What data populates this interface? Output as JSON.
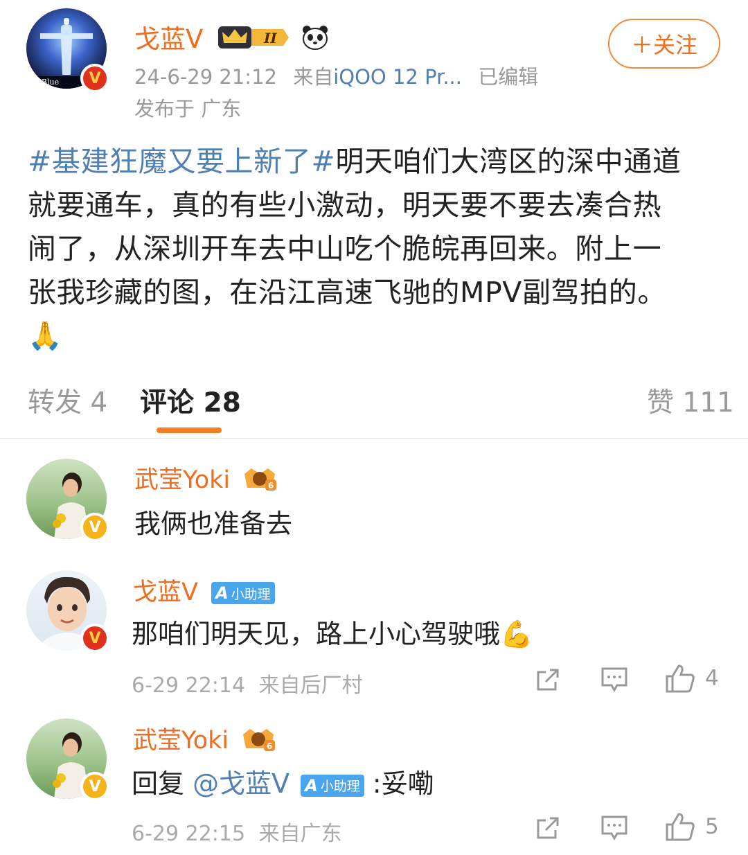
{
  "post": {
    "author": "戈蓝V",
    "level_badge": "II",
    "timestamp": "24-6-29 21:12",
    "source_prefix": "来自",
    "source_device": "iQOO 12 Pr...",
    "edited": "已编辑",
    "location": "发布于 广东",
    "follow_label": "＋关注",
    "avatar_caption": "t Blue",
    "hashtag": "#基建狂魔又要上新了#",
    "lines": [
      "明天咱们大湾区的深中通道",
      "就要通车，真的有些小激动，明天要不要去凑合热",
      "闹了，从深圳开车去中山吃个脆皖再回来。附上一",
      "张我珍藏的图，在沿江高速飞驰的MPV副驾拍的。"
    ],
    "emoji": "🙏"
  },
  "tabs": {
    "repost": "转发 4",
    "comments": "评论 28",
    "likes": "赞 111"
  },
  "comments": [
    {
      "name": "武莹Yoki",
      "text": "我俩也准备去"
    },
    {
      "name": "戈蓝V",
      "assistant_badge": "小助理",
      "text": "那咱们明天见，路上小心驾驶哦",
      "emoji": "💪",
      "time": "6-29 22:14",
      "source": "来自后厂村",
      "like_count": "4"
    },
    {
      "name": "武莹Yoki",
      "reply_prefix": "回复",
      "mention": "@戈蓝V",
      "assistant_badge": "小助理",
      "text": ":妥嘞",
      "time": "6-29 22:15",
      "source": "来自广东",
      "like_count": "5"
    }
  ],
  "colors": {
    "accent_orange": "#f06d1f",
    "link_blue": "#4f7fb3",
    "underline": "#f37d22"
  },
  "icons": [
    "crown-badge-icon",
    "panda-icon",
    "verified-red-icon",
    "verified-gold-icon",
    "share-icon",
    "comment-icon",
    "like-icon"
  ]
}
